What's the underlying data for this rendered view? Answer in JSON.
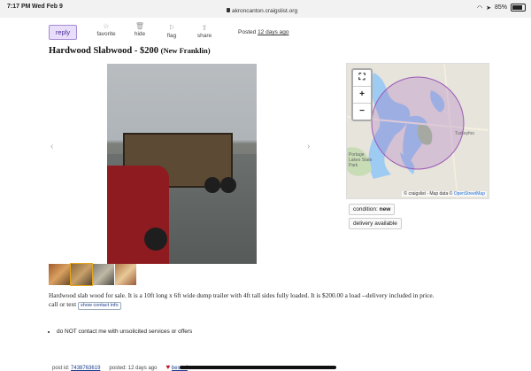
{
  "status_bar": {
    "time": "7:17 PM",
    "date": "Wed Feb 9",
    "url": "akroncanton.craigslist.org",
    "battery": "85%",
    "battery_level": 0.85
  },
  "toolbar": {
    "reply_label": "reply",
    "favorite_label": "favorite",
    "hide_label": "hide",
    "flag_label": "flag",
    "share_label": "share",
    "posted_label": "Posted",
    "posted_ago": "12 days ago"
  },
  "listing": {
    "title": "Hardwood Slabwood - $200",
    "location": "(New Franklin)",
    "description": "Hardwood slab wood for sale. It is a 10ft long x 6ft wide dump trailer with 4ft tall sides fully loaded. It is $200.00 a load --delivery included in price.",
    "call_or_text": "call or text",
    "show_contact_label": "show contact info",
    "notice": "do NOT contact me with unsolicited services or offers"
  },
  "gallery": {
    "prev_arrow": "‹",
    "next_arrow": "›",
    "thumbnail_count": 4,
    "active_thumbnail": 1
  },
  "map": {
    "fullscreen_icon": "⛶",
    "zoom_in": "+",
    "zoom_out": "−",
    "attribution": "© craigslist - Map data ©",
    "osm_link": "OpenStreetMap",
    "labels": {
      "turkeyfoot": "Turkeyfoo",
      "portage_lakes": "Portage Lakes State Park"
    }
  },
  "attributes": {
    "condition_label": "condition:",
    "condition_value": "new",
    "delivery": "delivery available"
  },
  "footer": {
    "post_id_label": "post id:",
    "post_id": "7438763619",
    "posted_label": "posted:",
    "posted_ago": "12 days ago",
    "best_of": "best of"
  },
  "colors": {
    "reply_bg": "#e9defa",
    "reply_text": "#4b2a97",
    "map_circle": "#9b59b6",
    "water": "#9ecbf2",
    "link": "#1a3b8a"
  }
}
